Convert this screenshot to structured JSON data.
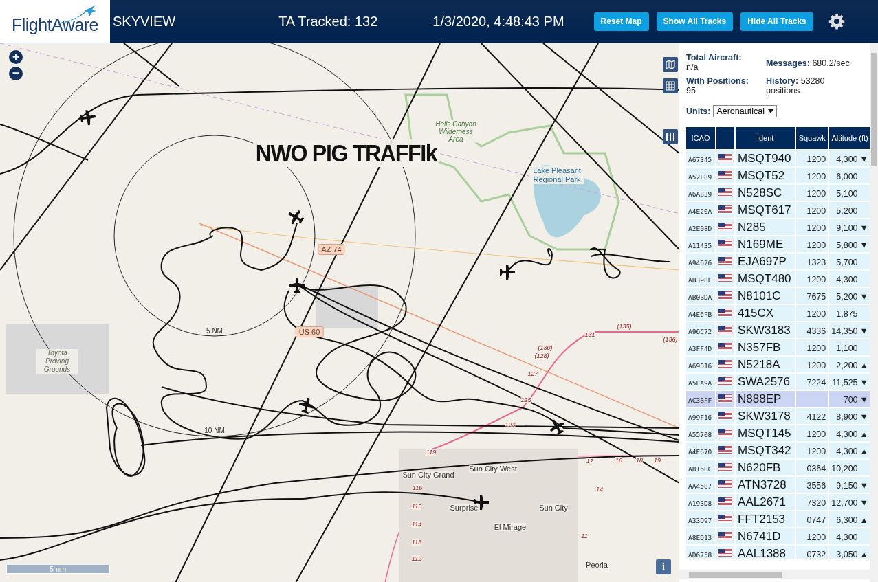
{
  "header": {
    "logo": "FlightAware",
    "title": "SKYVIEW",
    "tracked": "TA Tracked: 132",
    "datetime": "1/3/2020, 4:48:43 PM",
    "buttons": [
      "Reset Map",
      "Show All Tracks",
      "Hide All Tracks"
    ]
  },
  "map": {
    "overlay_title": "NWO PIG TRAFFIk",
    "scale": "5 nm",
    "zoom_in": "+",
    "zoom_out": "−",
    "info": "i",
    "labels": [
      {
        "text": "5 NM",
        "kind": "ring"
      },
      {
        "text": "10 NM",
        "kind": "ring"
      },
      {
        "text": "AZ 74",
        "kind": "shield"
      },
      {
        "text": "US 60",
        "kind": "shield"
      },
      {
        "text": "Hells Canyon Wilderness Area",
        "kind": "park"
      },
      {
        "text": "Lake Pleasant Regional Park",
        "kind": "water"
      },
      {
        "text": "Toyota Proving Grounds",
        "kind": "area"
      },
      {
        "text": "Sun City Grand",
        "kind": "place"
      },
      {
        "text": "Sun City West",
        "kind": "place"
      },
      {
        "text": "Surprise",
        "kind": "place"
      },
      {
        "text": "Sun City",
        "kind": "place"
      },
      {
        "text": "El Mirage",
        "kind": "place"
      },
      {
        "text": "Peoria",
        "kind": "place"
      },
      {
        "text": "(130)",
        "kind": "route"
      },
      {
        "text": "131",
        "kind": "route"
      },
      {
        "text": "(135)",
        "kind": "route"
      },
      {
        "text": "(136)",
        "kind": "route"
      },
      {
        "text": "(128)",
        "kind": "route"
      },
      {
        "text": "127",
        "kind": "route"
      },
      {
        "text": "125",
        "kind": "route"
      },
      {
        "text": "123",
        "kind": "route"
      },
      {
        "text": "119",
        "kind": "route"
      },
      {
        "text": "116",
        "kind": "route"
      },
      {
        "text": "115",
        "kind": "route"
      },
      {
        "text": "114",
        "kind": "route"
      },
      {
        "text": "113",
        "kind": "route"
      },
      {
        "text": "112",
        "kind": "route"
      },
      {
        "text": "17",
        "kind": "route"
      },
      {
        "text": "16",
        "kind": "route"
      },
      {
        "text": "18",
        "kind": "route"
      },
      {
        "text": "19",
        "kind": "route"
      },
      {
        "text": "14",
        "kind": "route"
      },
      {
        "text": "11",
        "kind": "route"
      }
    ]
  },
  "stats": [
    {
      "label": "Total Aircraft:",
      "value": "n/a"
    },
    {
      "label": "Messages:",
      "value": "680.2/sec"
    },
    {
      "label": "With Positions:",
      "value": "95"
    },
    {
      "label": "History:",
      "value": "53280 positions"
    }
  ],
  "units": {
    "label": "Units:",
    "value": "Aeronautical"
  },
  "table": {
    "columns": [
      "ICAO",
      "",
      "Ident",
      "Squawk",
      "Altitude (ft)"
    ],
    "rows": [
      {
        "icao": "A67345",
        "ident": "MSQT940",
        "squawk": "1200",
        "altitude": "4,300",
        "trend": "▼",
        "selected": false
      },
      {
        "icao": "A52F89",
        "ident": "MSQT52",
        "squawk": "1200",
        "altitude": "6,000",
        "trend": "",
        "selected": false
      },
      {
        "icao": "A6A839",
        "ident": "N528SC",
        "squawk": "1200",
        "altitude": "5,100",
        "trend": "",
        "selected": false
      },
      {
        "icao": "A4E20A",
        "ident": "MSQT617",
        "squawk": "1200",
        "altitude": "5,200",
        "trend": "",
        "selected": false
      },
      {
        "icao": "A2E08D",
        "ident": "N285",
        "squawk": "1200",
        "altitude": "9,100",
        "trend": "▼",
        "selected": false
      },
      {
        "icao": "A11435",
        "ident": "N169ME",
        "squawk": "1200",
        "altitude": "5,800",
        "trend": "▼",
        "selected": false
      },
      {
        "icao": "A94626",
        "ident": "EJA697P",
        "squawk": "1323",
        "altitude": "5,700",
        "trend": "",
        "selected": false
      },
      {
        "icao": "AB398F",
        "ident": "MSQT480",
        "squawk": "1200",
        "altitude": "4,300",
        "trend": "",
        "selected": false
      },
      {
        "icao": "AB0BDA",
        "ident": "N8101C",
        "squawk": "7675",
        "altitude": "5,200",
        "trend": "▼",
        "selected": false
      },
      {
        "icao": "A4E6FB",
        "ident": "415CX",
        "squawk": "1200",
        "altitude": "1,875",
        "trend": "",
        "selected": false
      },
      {
        "icao": "A96C72",
        "ident": "SKW3183",
        "squawk": "4336",
        "altitude": "14,350",
        "trend": "▼",
        "selected": false
      },
      {
        "icao": "A3FF4D",
        "ident": "N357FB",
        "squawk": "1200",
        "altitude": "1,100",
        "trend": "",
        "selected": false
      },
      {
        "icao": "A69016",
        "ident": "N5218A",
        "squawk": "1200",
        "altitude": "2,200",
        "trend": "▲",
        "selected": false
      },
      {
        "icao": "A5EA9A",
        "ident": "SWA2576",
        "squawk": "7224",
        "altitude": "11,525",
        "trend": "▼",
        "selected": false
      },
      {
        "icao": "AC3BFF",
        "ident": "N888EP",
        "squawk": "",
        "altitude": "700",
        "trend": "▼",
        "selected": true
      },
      {
        "icao": "A99F16",
        "ident": "SKW3178",
        "squawk": "4122",
        "altitude": "8,900",
        "trend": "▼",
        "selected": false
      },
      {
        "icao": "A55708",
        "ident": "MSQT145",
        "squawk": "1200",
        "altitude": "4,300",
        "trend": "▲",
        "selected": false
      },
      {
        "icao": "A4E670",
        "ident": "MSQT342",
        "squawk": "1200",
        "altitude": "4,300",
        "trend": "▲",
        "selected": false
      },
      {
        "icao": "A816BC",
        "ident": "N620FB",
        "squawk": "0364",
        "altitude": "10,200",
        "trend": "",
        "selected": false
      },
      {
        "icao": "AA4587",
        "ident": "ATN3728",
        "squawk": "3556",
        "altitude": "9,150",
        "trend": "▼",
        "selected": false
      },
      {
        "icao": "A193D8",
        "ident": "AAL2671",
        "squawk": "7320",
        "altitude": "12,700",
        "trend": "▼",
        "selected": false
      },
      {
        "icao": "A33D97",
        "ident": "FFT2153",
        "squawk": "0747",
        "altitude": "6,300",
        "trend": "▲",
        "selected": false
      },
      {
        "icao": "A8ED13",
        "ident": "N6741D",
        "squawk": "1200",
        "altitude": "4,300",
        "trend": "",
        "selected": false
      },
      {
        "icao": "AD6758",
        "ident": "AAL1388",
        "squawk": "0732",
        "altitude": "3,050",
        "trend": "▲",
        "selected": false
      }
    ]
  }
}
